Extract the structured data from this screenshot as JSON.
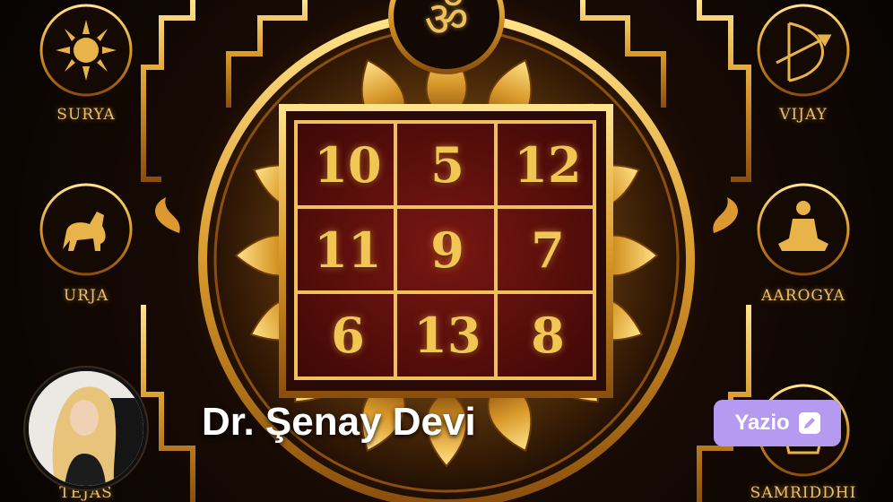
{
  "yantra": {
    "om_symbol": "ॐ",
    "grid": [
      [
        "10",
        "5",
        "12"
      ],
      [
        "11",
        "9",
        "7"
      ],
      [
        "6",
        "13",
        "8"
      ]
    ],
    "emblems": {
      "top_left": "SURYA",
      "top_right": "VIJAY",
      "mid_left": "URJA",
      "mid_right": "AAROGYA",
      "bottom_left": "TEJAS",
      "bottom_right": "SAMRIDDHI"
    }
  },
  "author": {
    "name": "Dr. Şenay Devi"
  },
  "write_button": {
    "label": "Yazio",
    "icon": "pencil-icon"
  },
  "colors": {
    "gold": "#f2c653",
    "maroon": "#5a0f0c",
    "button": "#b49af0"
  }
}
